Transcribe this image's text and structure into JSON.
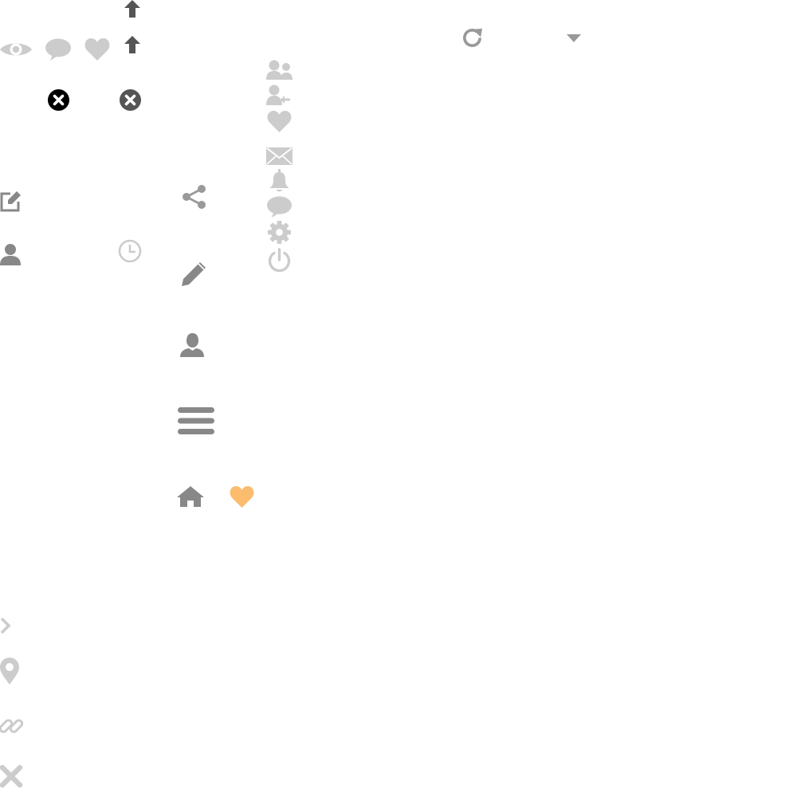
{
  "colors": {
    "light_gray": "#cccccc",
    "mid_gray": "#999999",
    "dark_gray": "#888888",
    "darker_gray": "#555555",
    "black": "#000000",
    "accent_orange": "#fcbc6e",
    "background": "#ffffff"
  },
  "icons": [
    "arrow-up-icon",
    "eye-icon",
    "comment-icon",
    "heart-icon",
    "close-circle-icon",
    "edit-icon",
    "user-icon",
    "clock-icon",
    "share-icon",
    "pencil-icon",
    "user-silhouette-icon",
    "menu-icon",
    "home-icon",
    "friends-icon",
    "add-friend-icon",
    "mail-icon",
    "bell-icon",
    "gear-icon",
    "power-icon",
    "refresh-icon",
    "caret-down-icon",
    "chevron-right-icon",
    "location-pin-icon",
    "link-icon",
    "close-x-icon"
  ]
}
